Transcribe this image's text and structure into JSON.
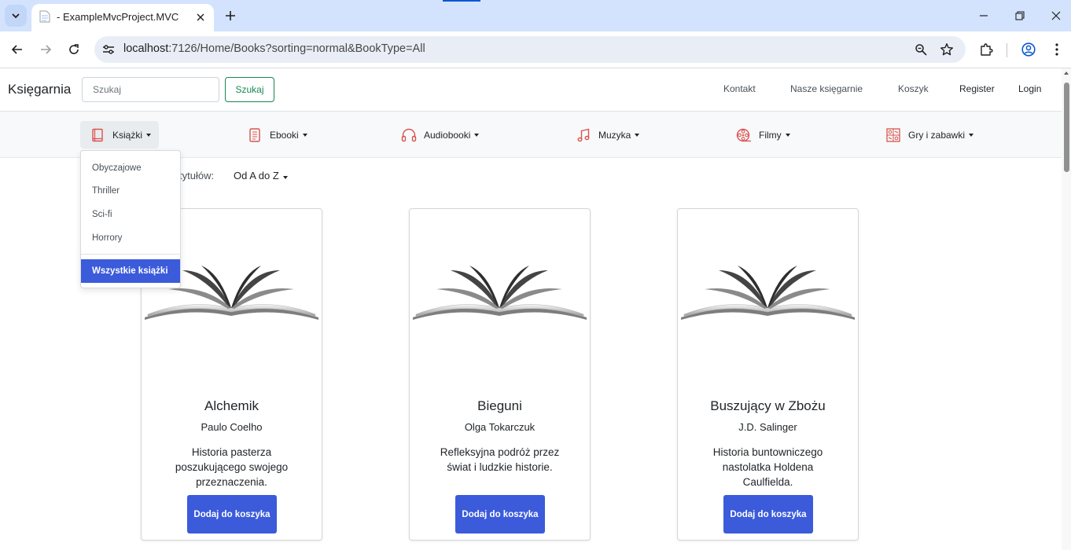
{
  "browser": {
    "tab_title": "- ExampleMvcProject.MVC",
    "url_host": "localhost",
    "url_rest": ":7126/Home/Books?sorting=normal&BookType=All",
    "accent": "#0b57d0"
  },
  "site": {
    "brand": "Księgarnia",
    "search_placeholder": "Szukaj",
    "search_button": "Szukaj",
    "links": [
      "Kontakt",
      "Nasze księgarnie",
      "Koszyk",
      "Register",
      "Login"
    ]
  },
  "categories": [
    {
      "label": "Książki",
      "icon": "book-icon"
    },
    {
      "label": "Ebooki",
      "icon": "ebook-icon"
    },
    {
      "label": "Audiobooki",
      "icon": "headphones-icon"
    },
    {
      "label": "Muzyka",
      "icon": "music-note-icon"
    },
    {
      "label": "Filmy",
      "icon": "film-reel-icon"
    },
    {
      "label": "Gry i zabawki",
      "icon": "game-icon"
    }
  ],
  "dropdown": {
    "items": [
      "Obyczajowe",
      "Thriller",
      "Sci-fi",
      "Horrory"
    ],
    "all_label": "Wszystkie książki"
  },
  "sorting": {
    "label_visible": "tytułów:",
    "value": "Od A do Z"
  },
  "books": [
    {
      "title": "Alchemik",
      "author": "Paulo Coelho",
      "description": "Historia pasterza poszukującego swojego przeznaczenia.",
      "button": "Dodaj do koszyka"
    },
    {
      "title": "Bieguni",
      "author": "Olga Tokarczuk",
      "description": "Refleksyjna podróż przez świat i ludzkie historie.",
      "button": "Dodaj do koszyka"
    },
    {
      "title": "Buszujący w Zbożu",
      "author": "J.D. Salinger",
      "description": "Historia buntowniczego nastolatka Holdena Caulfielda.",
      "button": "Dodaj do koszyka"
    }
  ],
  "colors": {
    "primary": "#3b5bdb",
    "success": "#198754",
    "category_icon": "#d9534f"
  }
}
